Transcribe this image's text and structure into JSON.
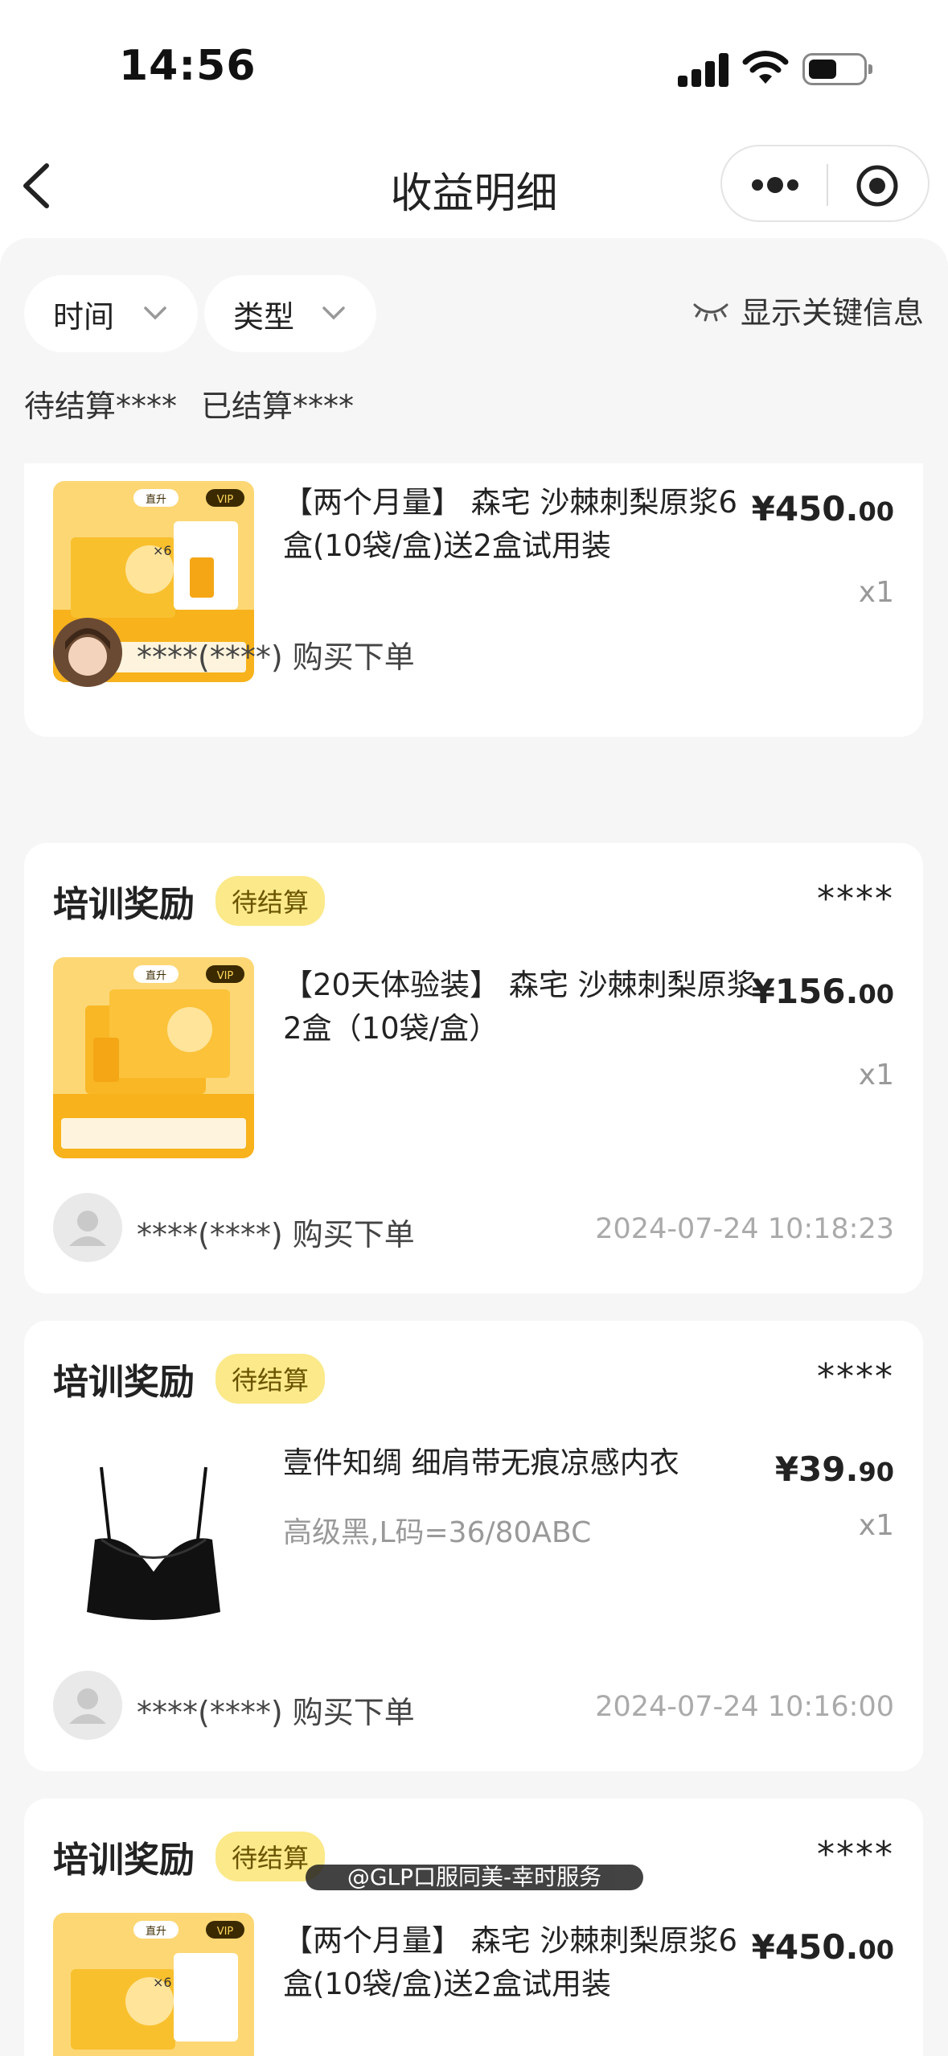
{
  "status_bar": {
    "time": "14:56"
  },
  "nav": {
    "title": "收益明细"
  },
  "filters": {
    "time_label": "时间",
    "type_label": "类型",
    "show_key_info": "显示关键信息"
  },
  "summary": {
    "pending": "待结算****",
    "settled": "已结算****"
  },
  "cards": [
    {
      "product_name": "【两个月量】 森宅 沙棘刺梨原浆6盒(10袋/盒)送2盒试用装",
      "price_main": "¥450.",
      "price_cents": "00",
      "qty": "x1",
      "buyer": "****(****) 购买下单"
    },
    {
      "type": "培训奖励",
      "status": "待结算",
      "amount": "****",
      "product_name": "【20天体验装】 森宅 沙棘刺梨原浆 2盒（10袋/盒）",
      "price_main": "¥156.",
      "price_cents": "00",
      "qty": "x1",
      "buyer": "****(****) 购买下单",
      "time": "2024-07-24 10:18:23"
    },
    {
      "type": "培训奖励",
      "status": "待结算",
      "amount": "****",
      "product_name": "壹件知绸 细肩带无痕凉感内衣",
      "sku": "高级黑,L码=36/80ABC",
      "price_main": "¥39.",
      "price_cents": "90",
      "qty": "x1",
      "buyer": "****(****) 购买下单",
      "time": "2024-07-24 10:16:00"
    },
    {
      "type": "培训奖励",
      "status": "待结算",
      "amount": "****",
      "product_name": "【两个月量】 森宅 沙棘刺梨原浆6盒(10袋/盒)送2盒试用装",
      "price_main": "¥450.",
      "price_cents": "00"
    }
  ],
  "thumb_text": {
    "vip": "VIP",
    "tag": "直升",
    "x6": "×6"
  },
  "watermark": "@GLP口服同美-幸时服务",
  "colors": {
    "badge_bg": "#fbe98a",
    "page_bg": "#f6f6f6",
    "product_orange": "#f7b21c"
  }
}
